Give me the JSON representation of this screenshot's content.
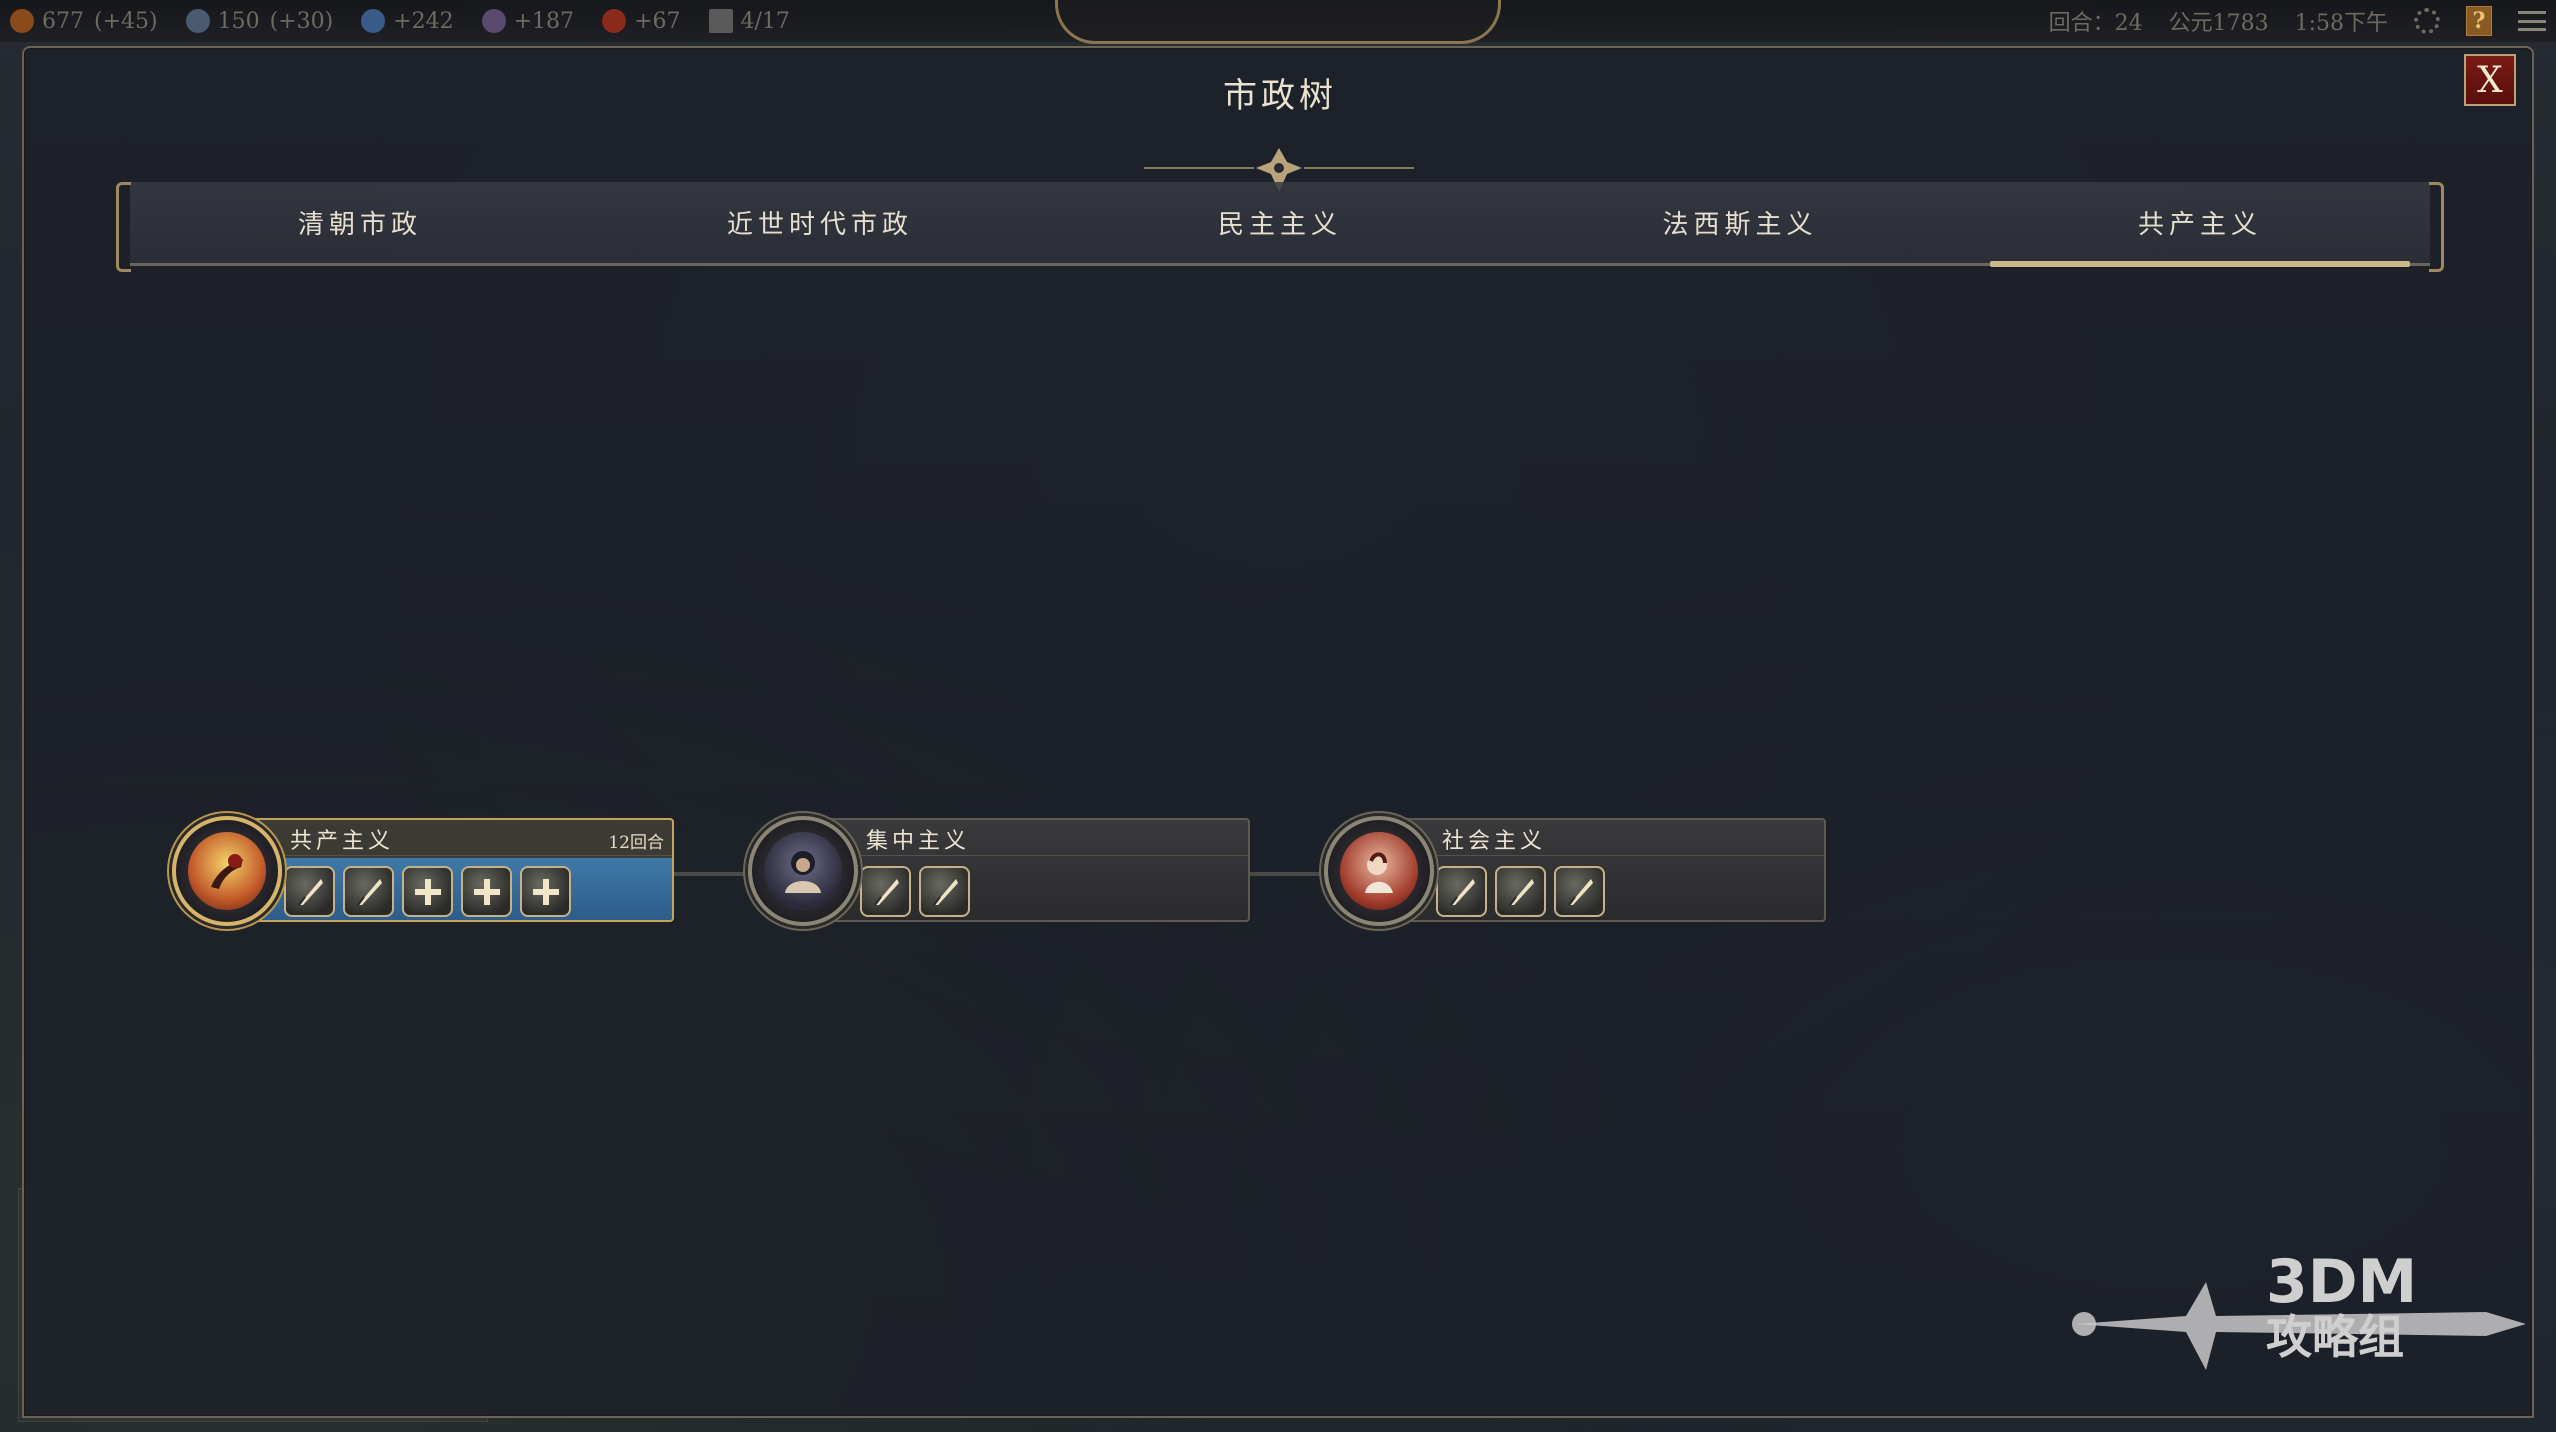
{
  "topbar": {
    "resources": [
      {
        "icon": "gold-coin-icon",
        "value": "677",
        "delta": "(+45)",
        "color": "#8a4a1a"
      },
      {
        "icon": "science-globe-icon",
        "value": "150",
        "delta": "(+30)",
        "color": "#4a5a70"
      },
      {
        "icon": "faith-flask-icon",
        "value": "+242",
        "delta": "",
        "color": "#3a5a8a"
      },
      {
        "icon": "music-note-icon",
        "value": "+187",
        "delta": "",
        "color": "#5a4a70"
      },
      {
        "icon": "influence-icon",
        "value": "+67",
        "delta": "",
        "color": "#8a2a1a"
      },
      {
        "icon": "building-icon",
        "value": "4/17",
        "delta": "",
        "color": "#5a5a5a"
      }
    ],
    "turn_text": "回合：24",
    "year_text": "公元1783",
    "time_text": "1:58下午"
  },
  "panel": {
    "title": "市政树",
    "close_label": "X"
  },
  "tabs": [
    {
      "label": "清朝市政",
      "active": false
    },
    {
      "label": "近世时代市政",
      "active": false
    },
    {
      "label": "民主主义",
      "active": false
    },
    {
      "label": "法西斯主义",
      "active": false
    },
    {
      "label": "共产主义",
      "active": true
    }
  ],
  "civics": [
    {
      "name": "共产主义",
      "turns": "12回合",
      "active": true,
      "portrait": "communism-portrait-icon",
      "unlocks": [
        "quill-icon",
        "quill-icon",
        "plus-icon",
        "plus-icon",
        "plus-icon"
      ]
    },
    {
      "name": "集中主义",
      "turns": "",
      "active": false,
      "portrait": "centralism-portrait-icon",
      "unlocks": [
        "quill-icon",
        "quill-icon"
      ]
    },
    {
      "name": "社会主义",
      "turns": "",
      "active": false,
      "portrait": "socialism-portrait-icon",
      "unlocks": [
        "quill-icon",
        "quill-icon",
        "quill-icon"
      ]
    }
  ],
  "watermark": {
    "line1": "3DM",
    "line2": "攻略组"
  },
  "colors": {
    "accent_gold": "#c7a25a",
    "active_blue": "#3f79a8",
    "close_red": "#7a1a14"
  }
}
